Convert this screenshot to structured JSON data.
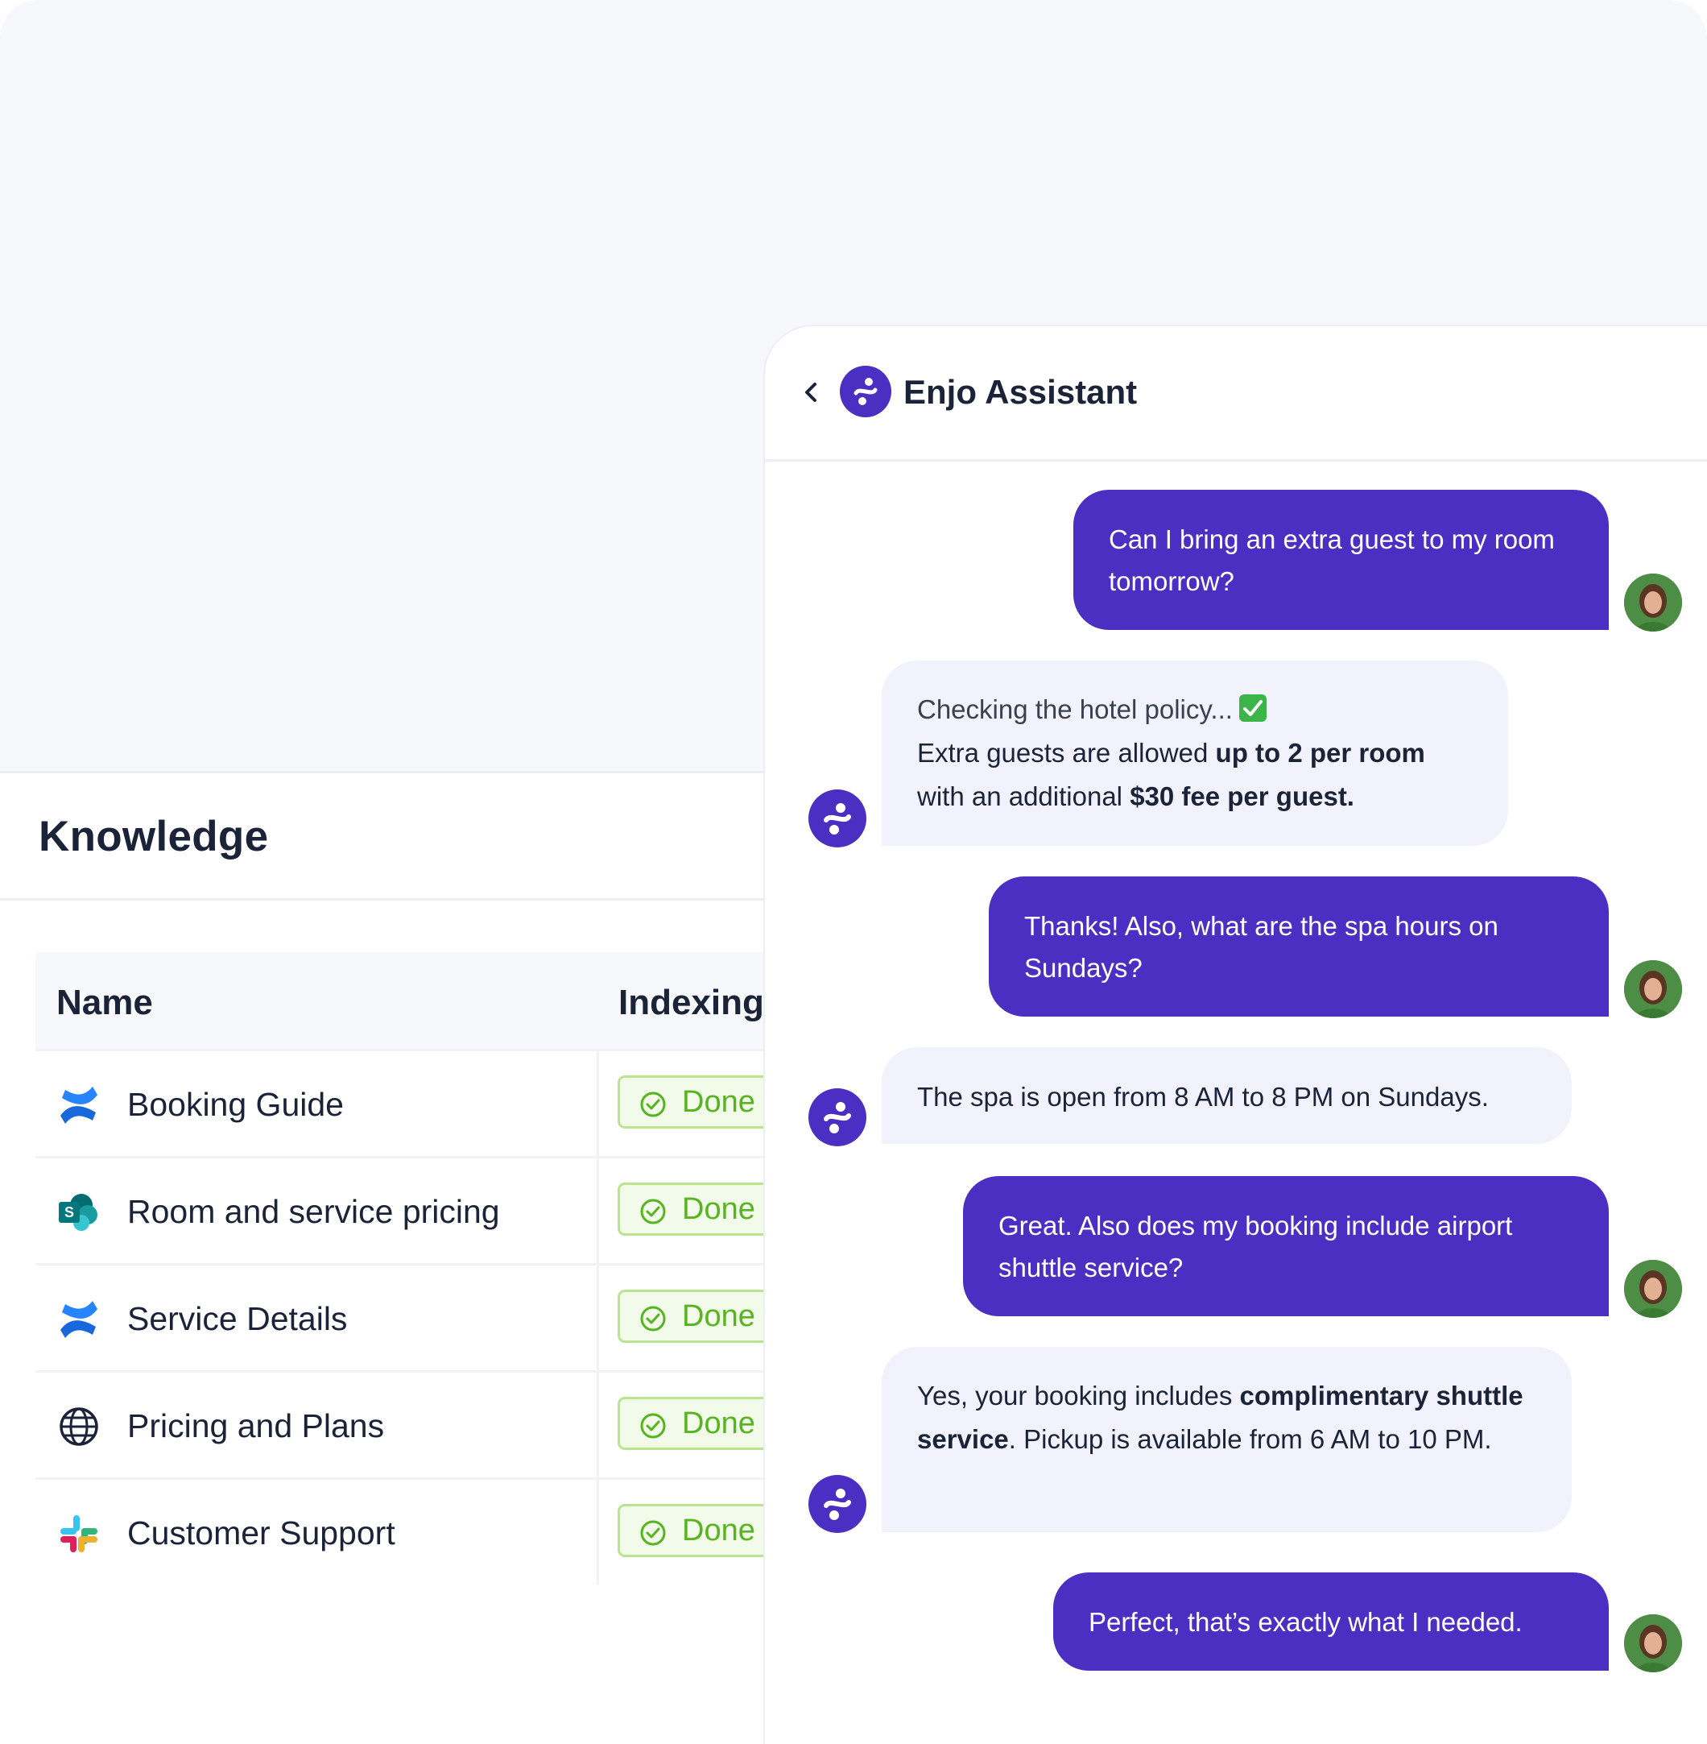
{
  "knowledge": {
    "title": "Knowledge",
    "columns": [
      "Name",
      "Indexing"
    ],
    "rows": [
      {
        "name": "Booking Guide",
        "icon": "confluence-icon",
        "status": "Done"
      },
      {
        "name": "Room and service pricing",
        "icon": "sharepoint-icon",
        "status": "Done"
      },
      {
        "name": "Service Details",
        "icon": "confluence-icon",
        "status": "Done"
      },
      {
        "name": "Pricing and Plans",
        "icon": "globe-icon",
        "status": "Done"
      },
      {
        "name": "Customer Support",
        "icon": "slack-icon",
        "status": "Done"
      }
    ]
  },
  "chat": {
    "title": "Enjo Assistant",
    "messages": [
      {
        "role": "user",
        "text": "Can I bring an extra guest to my room tomorrow?"
      },
      {
        "role": "bot",
        "line1": "Checking the hotel policy...",
        "line2a": "Extra guests are allowed ",
        "line2b": "up to 2 per room",
        "line3a": "with an additional ",
        "line3b": "$30 fee per guest."
      },
      {
        "role": "user",
        "text": "Thanks! Also, what are the spa hours on Sundays?"
      },
      {
        "role": "bot",
        "text": "The spa is open from 8 AM to 8 PM on Sundays."
      },
      {
        "role": "user",
        "text": "Great. Also does my booking include airport shuttle service?"
      },
      {
        "role": "bot",
        "p1": "Yes, your booking includes ",
        "p2": "complimentary shuttle service",
        "p3": ". Pickup is available from 6 AM to 10 PM."
      },
      {
        "role": "user",
        "text": "Perfect, that’s exactly what I needed."
      }
    ]
  },
  "colors": {
    "accent": "#4a2fc2",
    "done_text": "#56b41f",
    "done_border": "#b9e58f",
    "bot_bubble": "#f1f2fb"
  }
}
